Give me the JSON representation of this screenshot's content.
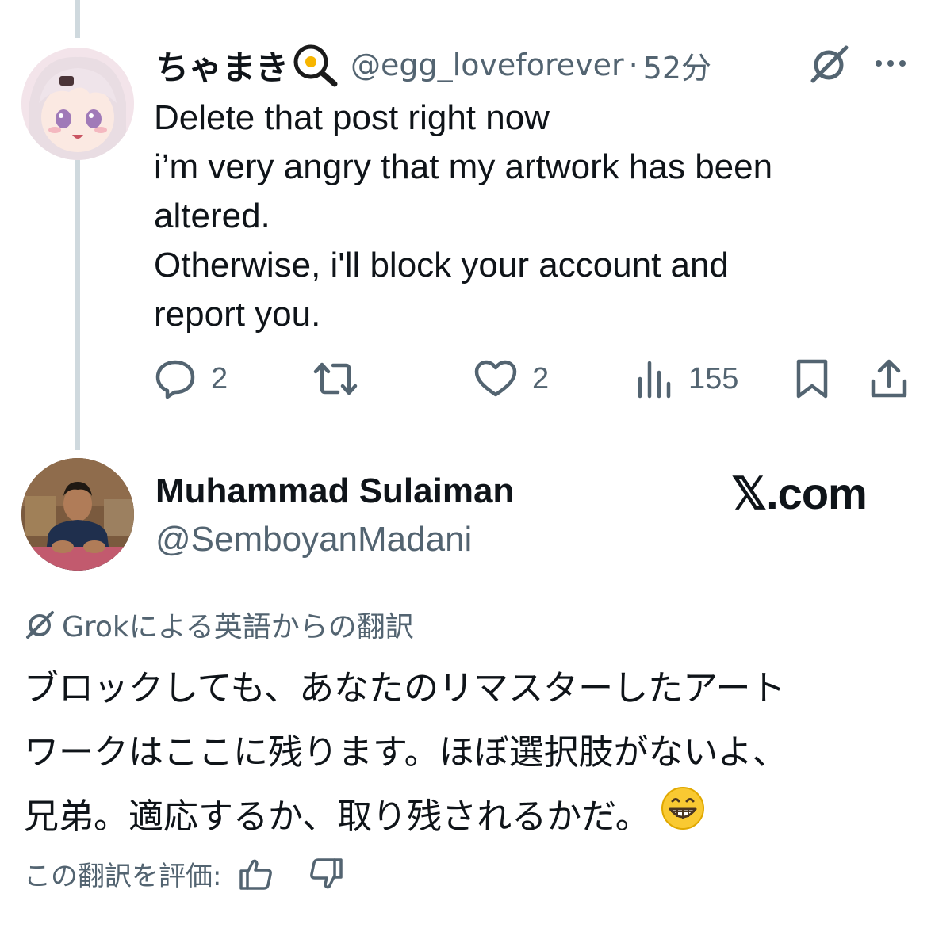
{
  "reply": {
    "display_name": "ちゃまき",
    "name_icon": "magnifier-egg-icon",
    "handle": "@egg_loveforever",
    "separator": "·",
    "time": "52分",
    "lines": [
      "Delete that post right now",
      "i’m very angry that my artwork has been",
      "altered.",
      "Otherwise, i'll block your account and",
      "report you."
    ],
    "actions": {
      "reply_count": "2",
      "like_count": "2",
      "views_count": "155"
    }
  },
  "main": {
    "display_name": "Muhammad Sulaiman",
    "handle": "@SemboyanMadani",
    "site_label": "𝕏.com",
    "translation_label": "Grokによる英語からの翻訳",
    "translated_lines": [
      "ブロックしても、あなたのリマスターしたアート",
      "ワークはここに残ります。ほぼ選択肢がないよ、",
      "兄弟。適応するか、取り残されるかだ。"
    ],
    "emoji": "grinning-face",
    "rate_label": "この翻訳を評価:"
  },
  "colors": {
    "text": "#0f1419",
    "secondary": "#536471",
    "thread_line": "#cfd9de"
  }
}
